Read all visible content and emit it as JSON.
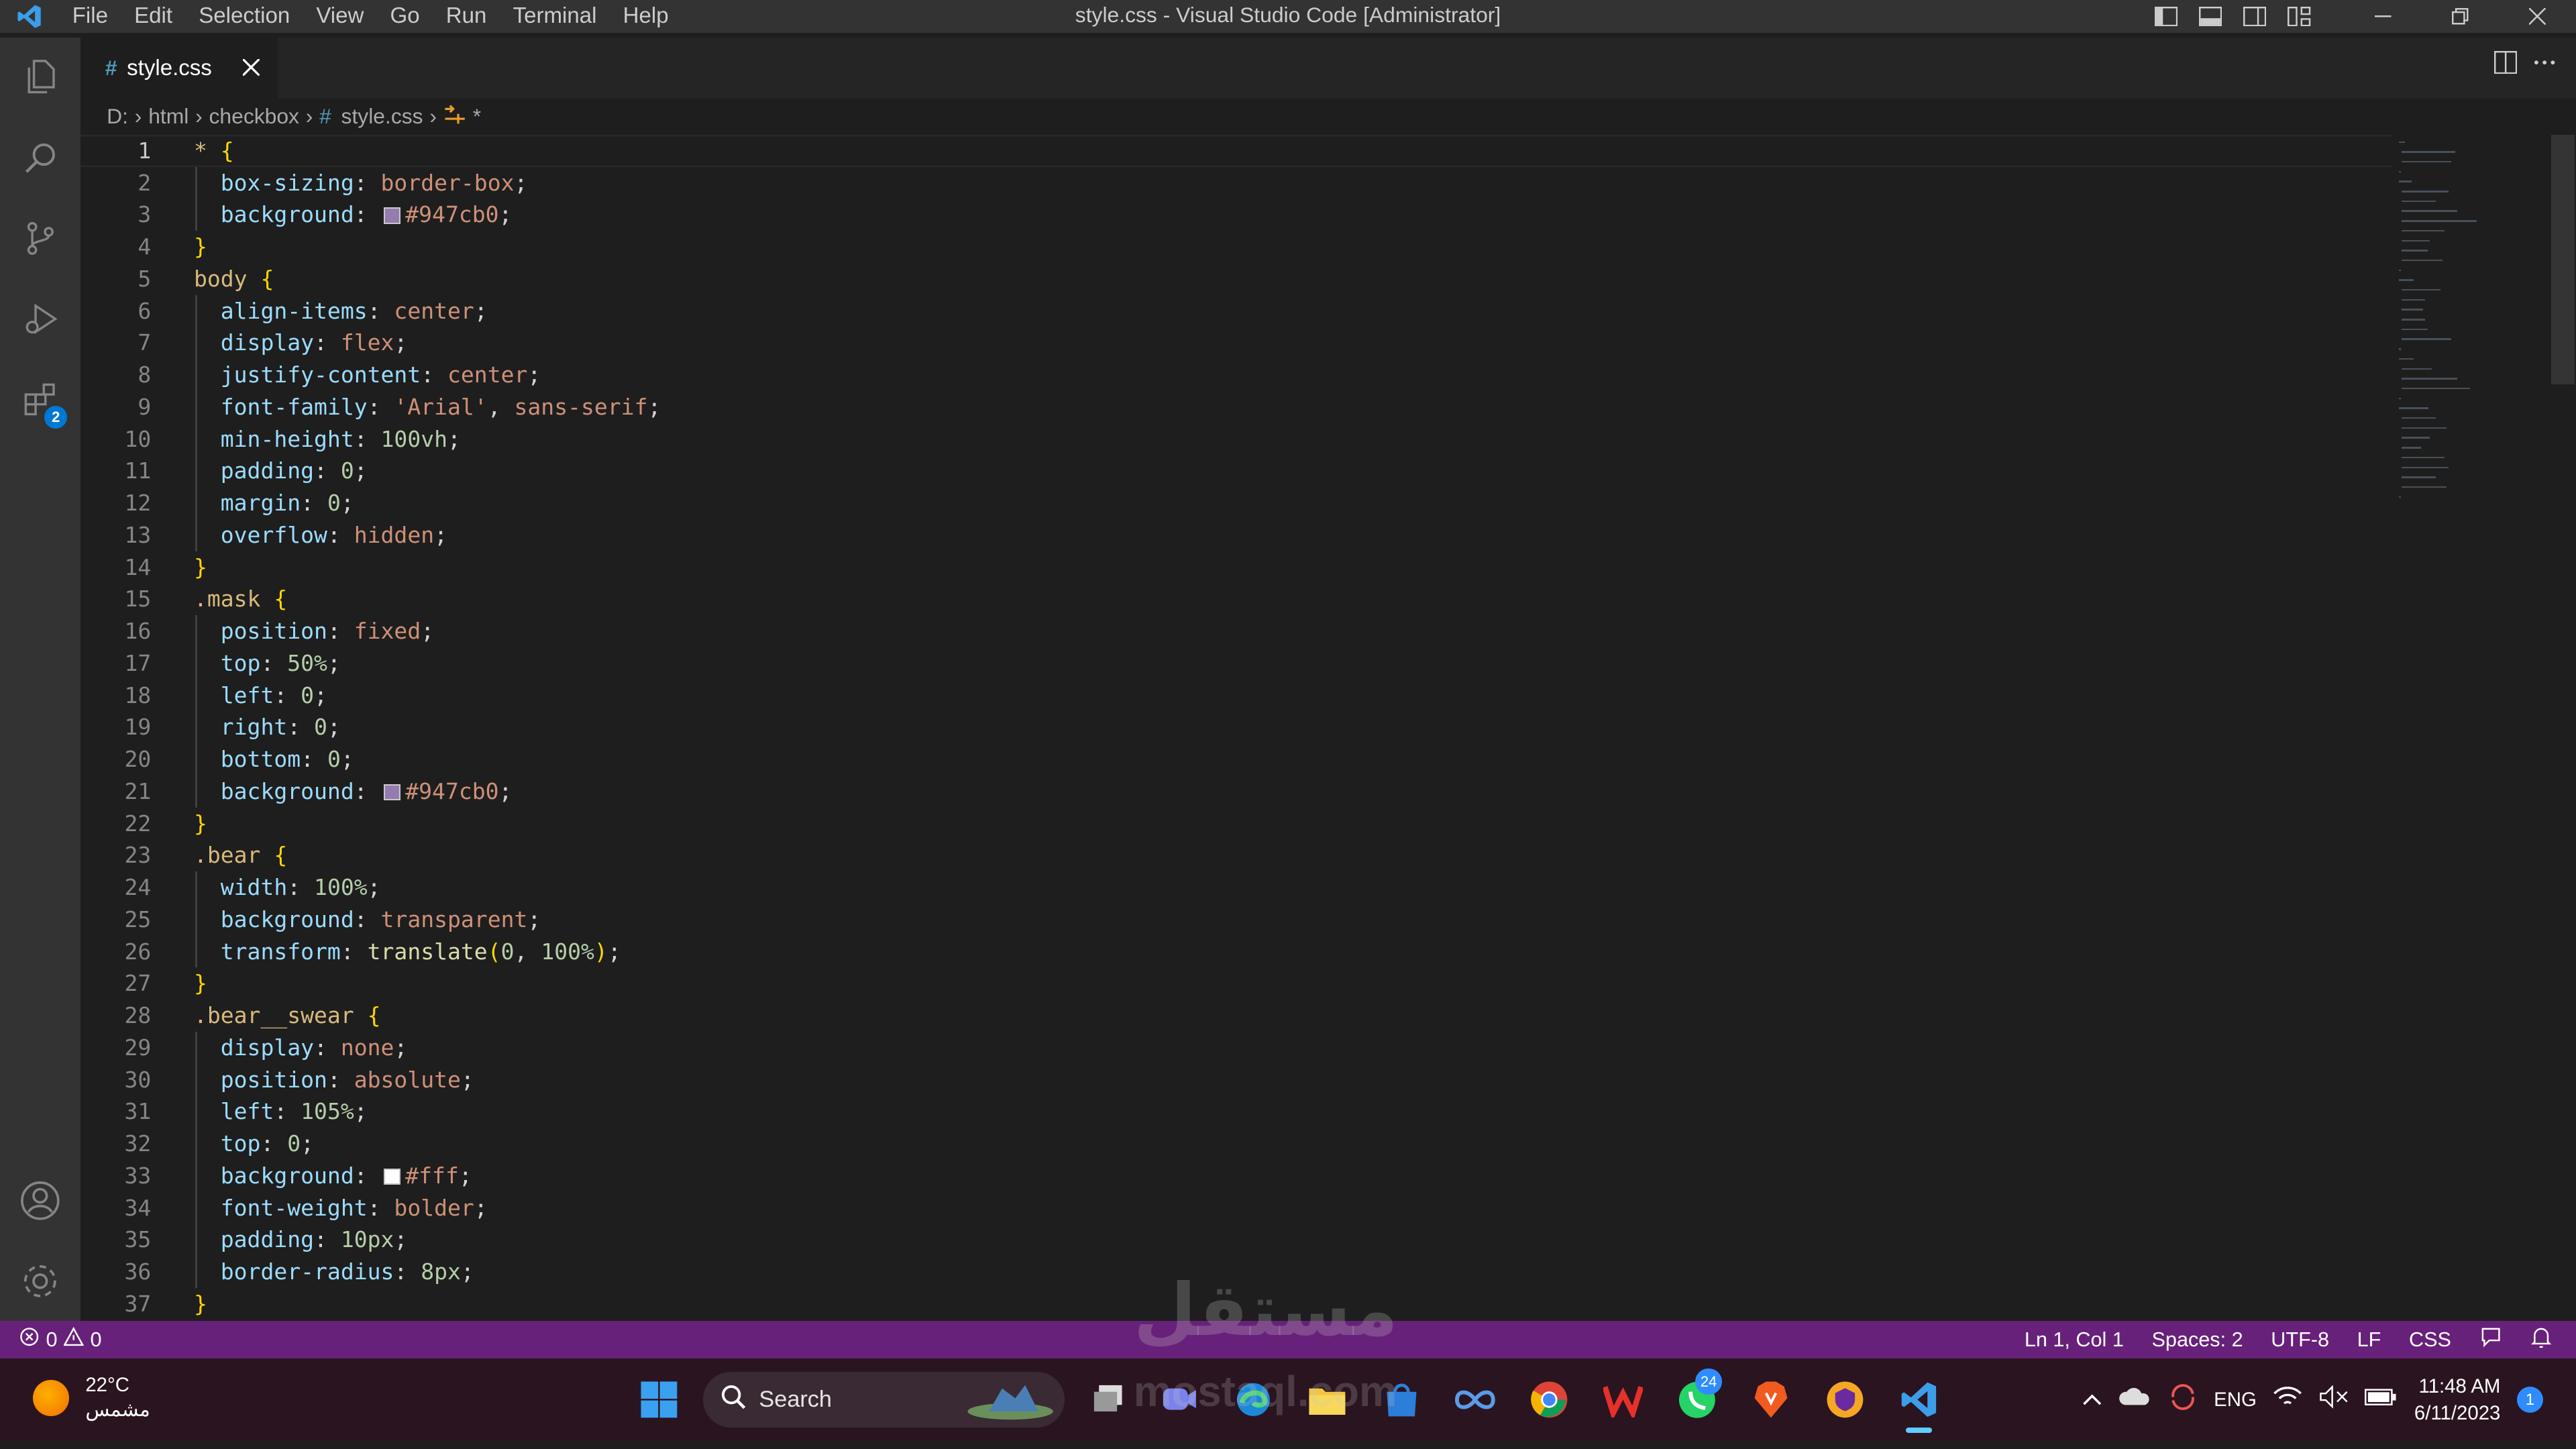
{
  "title_bar": {
    "menu": [
      "File",
      "Edit",
      "Selection",
      "View",
      "Go",
      "Run",
      "Terminal",
      "Help"
    ],
    "window_title": "style.css - Visual Studio Code [Administrator]"
  },
  "activity_bar": {
    "items": [
      "explorer-icon",
      "search-icon",
      "source-control-icon",
      "run-debug-icon",
      "extensions-icon"
    ],
    "extensions_badge": "2",
    "bottom_items": [
      "accounts-icon",
      "settings-gear-icon"
    ]
  },
  "tab": {
    "icon": "#",
    "label": "style.css"
  },
  "breadcrumb": {
    "parts": [
      "D:",
      "html",
      "checkbox"
    ],
    "file_icon": "#",
    "file": "style.css",
    "symbol": "*"
  },
  "editor": {
    "current_line": 1,
    "lines": [
      [
        [
          "* ",
          "t-sel"
        ],
        [
          "{",
          "t-brace"
        ]
      ],
      [
        [
          "  ",
          ""
        ],
        [
          "box-sizing",
          "t-prop"
        ],
        [
          ": ",
          "t-punc"
        ],
        [
          "border-box",
          "t-val"
        ],
        [
          ";",
          "t-punc"
        ]
      ],
      [
        [
          "  ",
          ""
        ],
        [
          "background",
          "t-prop"
        ],
        [
          ": ",
          "t-punc"
        ],
        [
          "@#947cb0",
          ""
        ],
        [
          "#947cb0",
          "t-val"
        ],
        [
          ";",
          "t-punc"
        ]
      ],
      [
        [
          "}",
          "t-brace"
        ]
      ],
      [
        [
          "body ",
          "t-sel"
        ],
        [
          "{",
          "t-brace"
        ]
      ],
      [
        [
          "  ",
          ""
        ],
        [
          "align-items",
          "t-prop"
        ],
        [
          ": ",
          "t-punc"
        ],
        [
          "center",
          "t-val"
        ],
        [
          ";",
          "t-punc"
        ]
      ],
      [
        [
          "  ",
          ""
        ],
        [
          "display",
          "t-prop"
        ],
        [
          ": ",
          "t-punc"
        ],
        [
          "flex",
          "t-val"
        ],
        [
          ";",
          "t-punc"
        ]
      ],
      [
        [
          "  ",
          ""
        ],
        [
          "justify-content",
          "t-prop"
        ],
        [
          ": ",
          "t-punc"
        ],
        [
          "center",
          "t-val"
        ],
        [
          ";",
          "t-punc"
        ]
      ],
      [
        [
          "  ",
          ""
        ],
        [
          "font-family",
          "t-prop"
        ],
        [
          ": ",
          "t-punc"
        ],
        [
          "'Arial'",
          "t-str"
        ],
        [
          ", ",
          "t-punc"
        ],
        [
          "sans-serif",
          "t-val"
        ],
        [
          ";",
          "t-punc"
        ]
      ],
      [
        [
          "  ",
          ""
        ],
        [
          "min-height",
          "t-prop"
        ],
        [
          ": ",
          "t-punc"
        ],
        [
          "100vh",
          "t-num"
        ],
        [
          ";",
          "t-punc"
        ]
      ],
      [
        [
          "  ",
          ""
        ],
        [
          "padding",
          "t-prop"
        ],
        [
          ": ",
          "t-punc"
        ],
        [
          "0",
          "t-num"
        ],
        [
          ";",
          "t-punc"
        ]
      ],
      [
        [
          "  ",
          ""
        ],
        [
          "margin",
          "t-prop"
        ],
        [
          ": ",
          "t-punc"
        ],
        [
          "0",
          "t-num"
        ],
        [
          ";",
          "t-punc"
        ]
      ],
      [
        [
          "  ",
          ""
        ],
        [
          "overflow",
          "t-prop"
        ],
        [
          ": ",
          "t-punc"
        ],
        [
          "hidden",
          "t-val"
        ],
        [
          ";",
          "t-punc"
        ]
      ],
      [
        [
          "}",
          "t-brace"
        ]
      ],
      [
        [
          ".mask ",
          "t-sel"
        ],
        [
          "{",
          "t-brace"
        ]
      ],
      [
        [
          "  ",
          ""
        ],
        [
          "position",
          "t-prop"
        ],
        [
          ": ",
          "t-punc"
        ],
        [
          "fixed",
          "t-val"
        ],
        [
          ";",
          "t-punc"
        ]
      ],
      [
        [
          "  ",
          ""
        ],
        [
          "top",
          "t-prop"
        ],
        [
          ": ",
          "t-punc"
        ],
        [
          "50%",
          "t-num"
        ],
        [
          ";",
          "t-punc"
        ]
      ],
      [
        [
          "  ",
          ""
        ],
        [
          "left",
          "t-prop"
        ],
        [
          ": ",
          "t-punc"
        ],
        [
          "0",
          "t-num"
        ],
        [
          ";",
          "t-punc"
        ]
      ],
      [
        [
          "  ",
          ""
        ],
        [
          "right",
          "t-prop"
        ],
        [
          ": ",
          "t-punc"
        ],
        [
          "0",
          "t-num"
        ],
        [
          ";",
          "t-punc"
        ]
      ],
      [
        [
          "  ",
          ""
        ],
        [
          "bottom",
          "t-prop"
        ],
        [
          ": ",
          "t-punc"
        ],
        [
          "0",
          "t-num"
        ],
        [
          ";",
          "t-punc"
        ]
      ],
      [
        [
          "  ",
          ""
        ],
        [
          "background",
          "t-prop"
        ],
        [
          ": ",
          "t-punc"
        ],
        [
          "@#947cb0",
          ""
        ],
        [
          "#947cb0",
          "t-val"
        ],
        [
          ";",
          "t-punc"
        ]
      ],
      [
        [
          "}",
          "t-brace"
        ]
      ],
      [
        [
          ".bear ",
          "t-sel"
        ],
        [
          "{",
          "t-brace"
        ]
      ],
      [
        [
          "  ",
          ""
        ],
        [
          "width",
          "t-prop"
        ],
        [
          ": ",
          "t-punc"
        ],
        [
          "100%",
          "t-num"
        ],
        [
          ";",
          "t-punc"
        ]
      ],
      [
        [
          "  ",
          ""
        ],
        [
          "background",
          "t-prop"
        ],
        [
          ": ",
          "t-punc"
        ],
        [
          "transparent",
          "t-val"
        ],
        [
          ";",
          "t-punc"
        ]
      ],
      [
        [
          "  ",
          ""
        ],
        [
          "transform",
          "t-prop"
        ],
        [
          ": ",
          "t-punc"
        ],
        [
          "translate",
          "t-fn"
        ],
        [
          "(",
          "t-brace"
        ],
        [
          "0",
          "t-num"
        ],
        [
          ", ",
          "t-punc"
        ],
        [
          "100%",
          "t-num"
        ],
        [
          ")",
          "t-brace"
        ],
        [
          ";",
          "t-punc"
        ]
      ],
      [
        [
          "}",
          "t-brace"
        ]
      ],
      [
        [
          ".bear__swear ",
          "t-sel"
        ],
        [
          "{",
          "t-brace"
        ]
      ],
      [
        [
          "  ",
          ""
        ],
        [
          "display",
          "t-prop"
        ],
        [
          ": ",
          "t-punc"
        ],
        [
          "none",
          "t-val"
        ],
        [
          ";",
          "t-punc"
        ]
      ],
      [
        [
          "  ",
          ""
        ],
        [
          "position",
          "t-prop"
        ],
        [
          ": ",
          "t-punc"
        ],
        [
          "absolute",
          "t-val"
        ],
        [
          ";",
          "t-punc"
        ]
      ],
      [
        [
          "  ",
          ""
        ],
        [
          "left",
          "t-prop"
        ],
        [
          ": ",
          "t-punc"
        ],
        [
          "105%",
          "t-num"
        ],
        [
          ";",
          "t-punc"
        ]
      ],
      [
        [
          "  ",
          ""
        ],
        [
          "top",
          "t-prop"
        ],
        [
          ": ",
          "t-punc"
        ],
        [
          "0",
          "t-num"
        ],
        [
          ";",
          "t-punc"
        ]
      ],
      [
        [
          "  ",
          ""
        ],
        [
          "background",
          "t-prop"
        ],
        [
          ": ",
          "t-punc"
        ],
        [
          "@#ffffff",
          ""
        ],
        [
          "#fff",
          "t-val"
        ],
        [
          ";",
          "t-punc"
        ]
      ],
      [
        [
          "  ",
          ""
        ],
        [
          "font-weight",
          "t-prop"
        ],
        [
          ": ",
          "t-punc"
        ],
        [
          "bolder",
          "t-val"
        ],
        [
          ";",
          "t-punc"
        ]
      ],
      [
        [
          "  ",
          ""
        ],
        [
          "padding",
          "t-prop"
        ],
        [
          ": ",
          "t-punc"
        ],
        [
          "10px",
          "t-num"
        ],
        [
          ";",
          "t-punc"
        ]
      ],
      [
        [
          "  ",
          ""
        ],
        [
          "border-radius",
          "t-prop"
        ],
        [
          ": ",
          "t-punc"
        ],
        [
          "8px",
          "t-num"
        ],
        [
          ";",
          "t-punc"
        ]
      ],
      [
        [
          "}",
          "t-brace"
        ]
      ]
    ]
  },
  "status_bar": {
    "errors": "0",
    "warnings": "0",
    "position": "Ln 1, Col 1",
    "spaces": "Spaces: 2",
    "encoding": "UTF-8",
    "eol": "LF",
    "language": "CSS"
  },
  "taskbar": {
    "weather_temp": "22°C",
    "weather_desc": "مشمس",
    "search_label": "Search",
    "whatsapp_badge": "24",
    "language": "ENG",
    "time": "11:48 AM",
    "date": "6/11/2023",
    "notification_count": "1"
  },
  "watermark": {
    "arabic": "مستقل",
    "latin": "mostaql.com"
  },
  "colors": {
    "statusbar": "#68217a",
    "swatch_purple": "#947cb0",
    "accent_blue": "#0078d4"
  }
}
